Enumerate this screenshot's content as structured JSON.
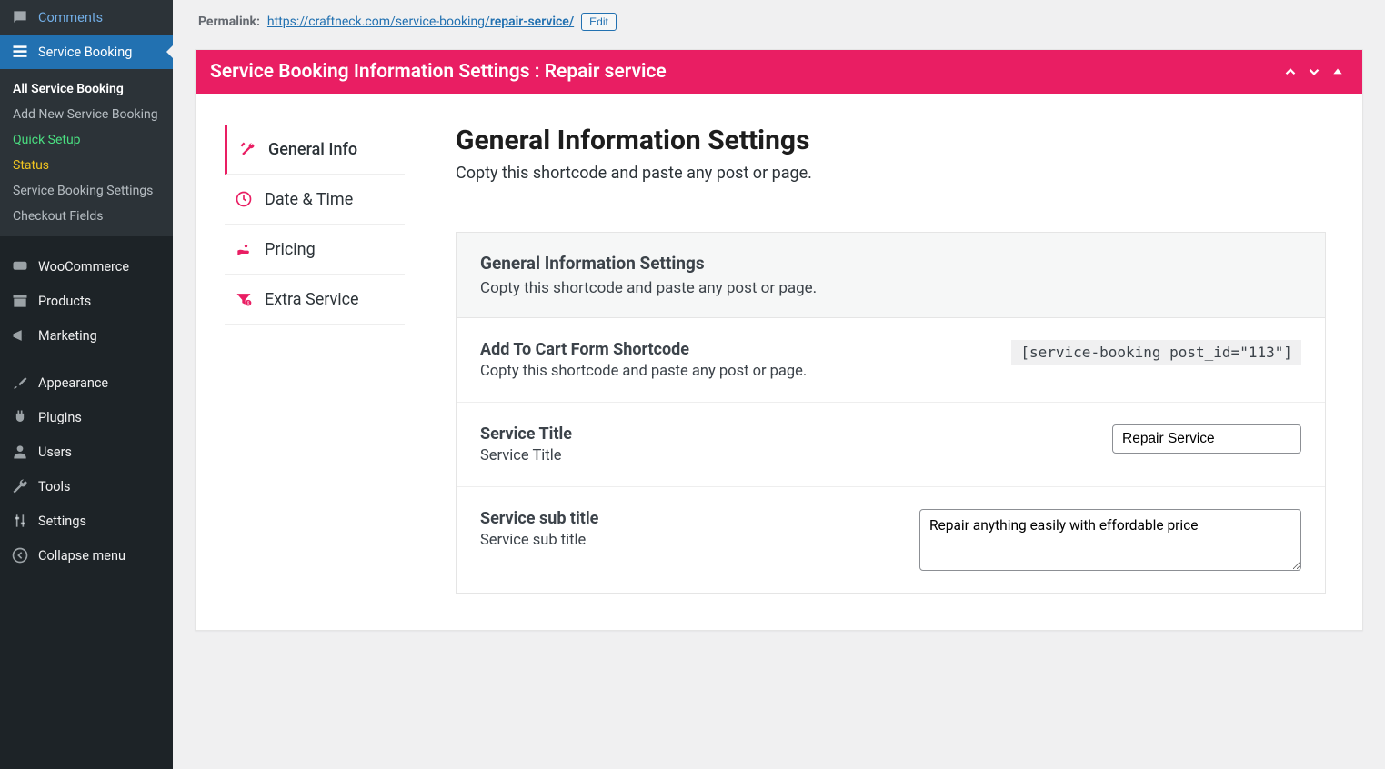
{
  "sidebar": {
    "items": [
      {
        "label": "Comments",
        "icon": "comment"
      },
      {
        "label": "Service Booking",
        "icon": "list",
        "active": true,
        "submenu": [
          {
            "label": "All Service Booking",
            "cls": "current"
          },
          {
            "label": "Add New Service Booking"
          },
          {
            "label": "Quick Setup",
            "cls": "highlight-green"
          },
          {
            "label": "Status",
            "cls": "highlight-yellow"
          },
          {
            "label": "Service Booking Settings"
          },
          {
            "label": "Checkout Fields"
          }
        ]
      },
      {
        "label": "WooCommerce",
        "icon": "woo"
      },
      {
        "label": "Products",
        "icon": "archive"
      },
      {
        "label": "Marketing",
        "icon": "megaphone"
      },
      {
        "sep": true
      },
      {
        "label": "Appearance",
        "icon": "brush"
      },
      {
        "label": "Plugins",
        "icon": "plug"
      },
      {
        "label": "Users",
        "icon": "user"
      },
      {
        "label": "Tools",
        "icon": "wrench"
      },
      {
        "label": "Settings",
        "icon": "settings"
      },
      {
        "label": "Collapse menu",
        "icon": "collapse"
      }
    ]
  },
  "permalink": {
    "label": "Permalink:",
    "base": "https://craftneck.com/service-booking/",
    "slug": "repair-service/",
    "edit": "Edit"
  },
  "metabox": {
    "title": "Service Booking Information Settings : Repair service"
  },
  "tabs": [
    {
      "label": "General Info",
      "icon": "tools",
      "active": true
    },
    {
      "label": "Date & Time",
      "icon": "clock"
    },
    {
      "label": "Pricing",
      "icon": "hand"
    },
    {
      "label": "Extra Service",
      "icon": "filter"
    }
  ],
  "panel": {
    "heading": "General Information Settings",
    "sub": "Copty this shortcode and paste any post or page."
  },
  "card": {
    "header_title": "General Information Settings",
    "header_sub": "Copty this shortcode and paste any post or page.",
    "shortcode_title": "Add To Cart Form Shortcode",
    "shortcode_sub": "Copty this shortcode and paste any post or page.",
    "shortcode_value": "[service-booking post_id=\"113\"]",
    "title_label": "Service Title",
    "title_sub": "Service Title",
    "title_value": "Repair Service",
    "subtitle_label": "Service sub title",
    "subtitle_sub": "Service sub title",
    "subtitle_value": "Repair anything easily with effordable price"
  }
}
